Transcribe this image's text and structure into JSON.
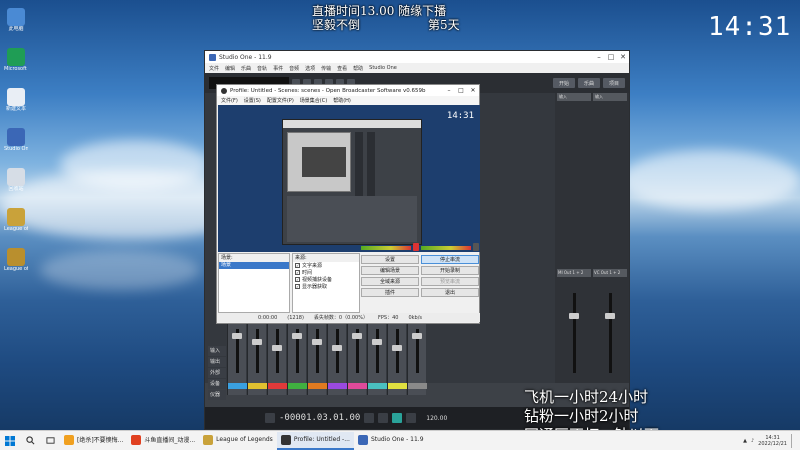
{
  "desktop": {
    "top_line1": "直播时间13.00 随缘下播",
    "top_line2": "坚毅不倒",
    "top_line2_right": "第5天",
    "clock": "14:31",
    "icons": [
      {
        "label": "此电脑",
        "color": "#4a8ad4"
      },
      {
        "label": "Microsoft Edge",
        "color": "#1f9d55"
      },
      {
        "label": "新建文本",
        "color": "#e9eef5"
      },
      {
        "label": "Studio One",
        "color": "#3b67b6"
      },
      {
        "label": "回收站",
        "color": "#d6dde6"
      },
      {
        "label": "League of Legends",
        "color": "#c9a23a"
      },
      {
        "label": "League of Legends",
        "color": "#b98f2e"
      }
    ],
    "overlay_lines": [
      "飞机一小时24小时",
      "钻粉一小时2小时",
      "网通区不打一钻以下"
    ]
  },
  "studio_one": {
    "title": "Studio One - 11.9",
    "menu": [
      "文件",
      "编辑",
      "乐曲",
      "音轨",
      "事件",
      "音频",
      "选项",
      "传输",
      "查看",
      "帮助",
      "Studio One"
    ],
    "toolbar_buttons": [
      "开始",
      "乐曲",
      "项目"
    ],
    "time": "-00001.03.01.00",
    "bpm": "120.00",
    "side_labels": [
      "输入",
      "输出",
      "外部",
      "设备",
      "仪器"
    ],
    "right_channels": [
      "MI Out 1 + 2",
      "VC Out 1 + 2"
    ],
    "channel_colors": [
      "#3aa0e0",
      "#e0c030",
      "#e03a3a",
      "#40b040",
      "#e07a20",
      "#9a4ae0",
      "#e04a9a",
      "#4ac0c0",
      "#e0e040",
      "#8a8a8a"
    ]
  },
  "obs": {
    "title": "Profile: Untitled - Scenes: scenes - Open Broadcaster Software v0.659b",
    "menu": [
      "文件(F)",
      "设置(S)",
      "配置文件(P)",
      "场景集合(C)",
      "帮助(H)"
    ],
    "preview_clock": "14:31",
    "scenes_header": "场景:",
    "scene_item": "场景",
    "sources_header": "来源:",
    "sources": [
      "文字来源",
      "时间",
      "视频捕获设备",
      "显示器获取"
    ],
    "buttons": {
      "settings": "设置",
      "stop_stream": "停止串流",
      "edit_scene": "编辑场景",
      "start_record": "开始录制",
      "global_sources": "全域来源",
      "preview": "预览串流",
      "plugins": "插件",
      "exit": "退出"
    },
    "status": {
      "time": "0:00:00",
      "bitrate": "(1218)",
      "dropped": "丢失帧数：0（0.00%）",
      "fps": "FPS：40",
      "kbps": "0kb/s"
    }
  },
  "taskbar": {
    "items": [
      {
        "label": "[绝杀]不要懊悔...",
        "color": "#f0a020",
        "active": false
      },
      {
        "label": "斗鱼直播间_动漫...",
        "color": "#e04020",
        "active": false
      },
      {
        "label": "League of Legends",
        "color": "#c9a23a",
        "active": false
      },
      {
        "label": "Profile: Untitled -...",
        "color": "#333333",
        "active": true
      },
      {
        "label": "Studio One - 11.9",
        "color": "#3b67b6",
        "active": false
      }
    ],
    "time": "14:31",
    "date": "2022/12/21"
  }
}
